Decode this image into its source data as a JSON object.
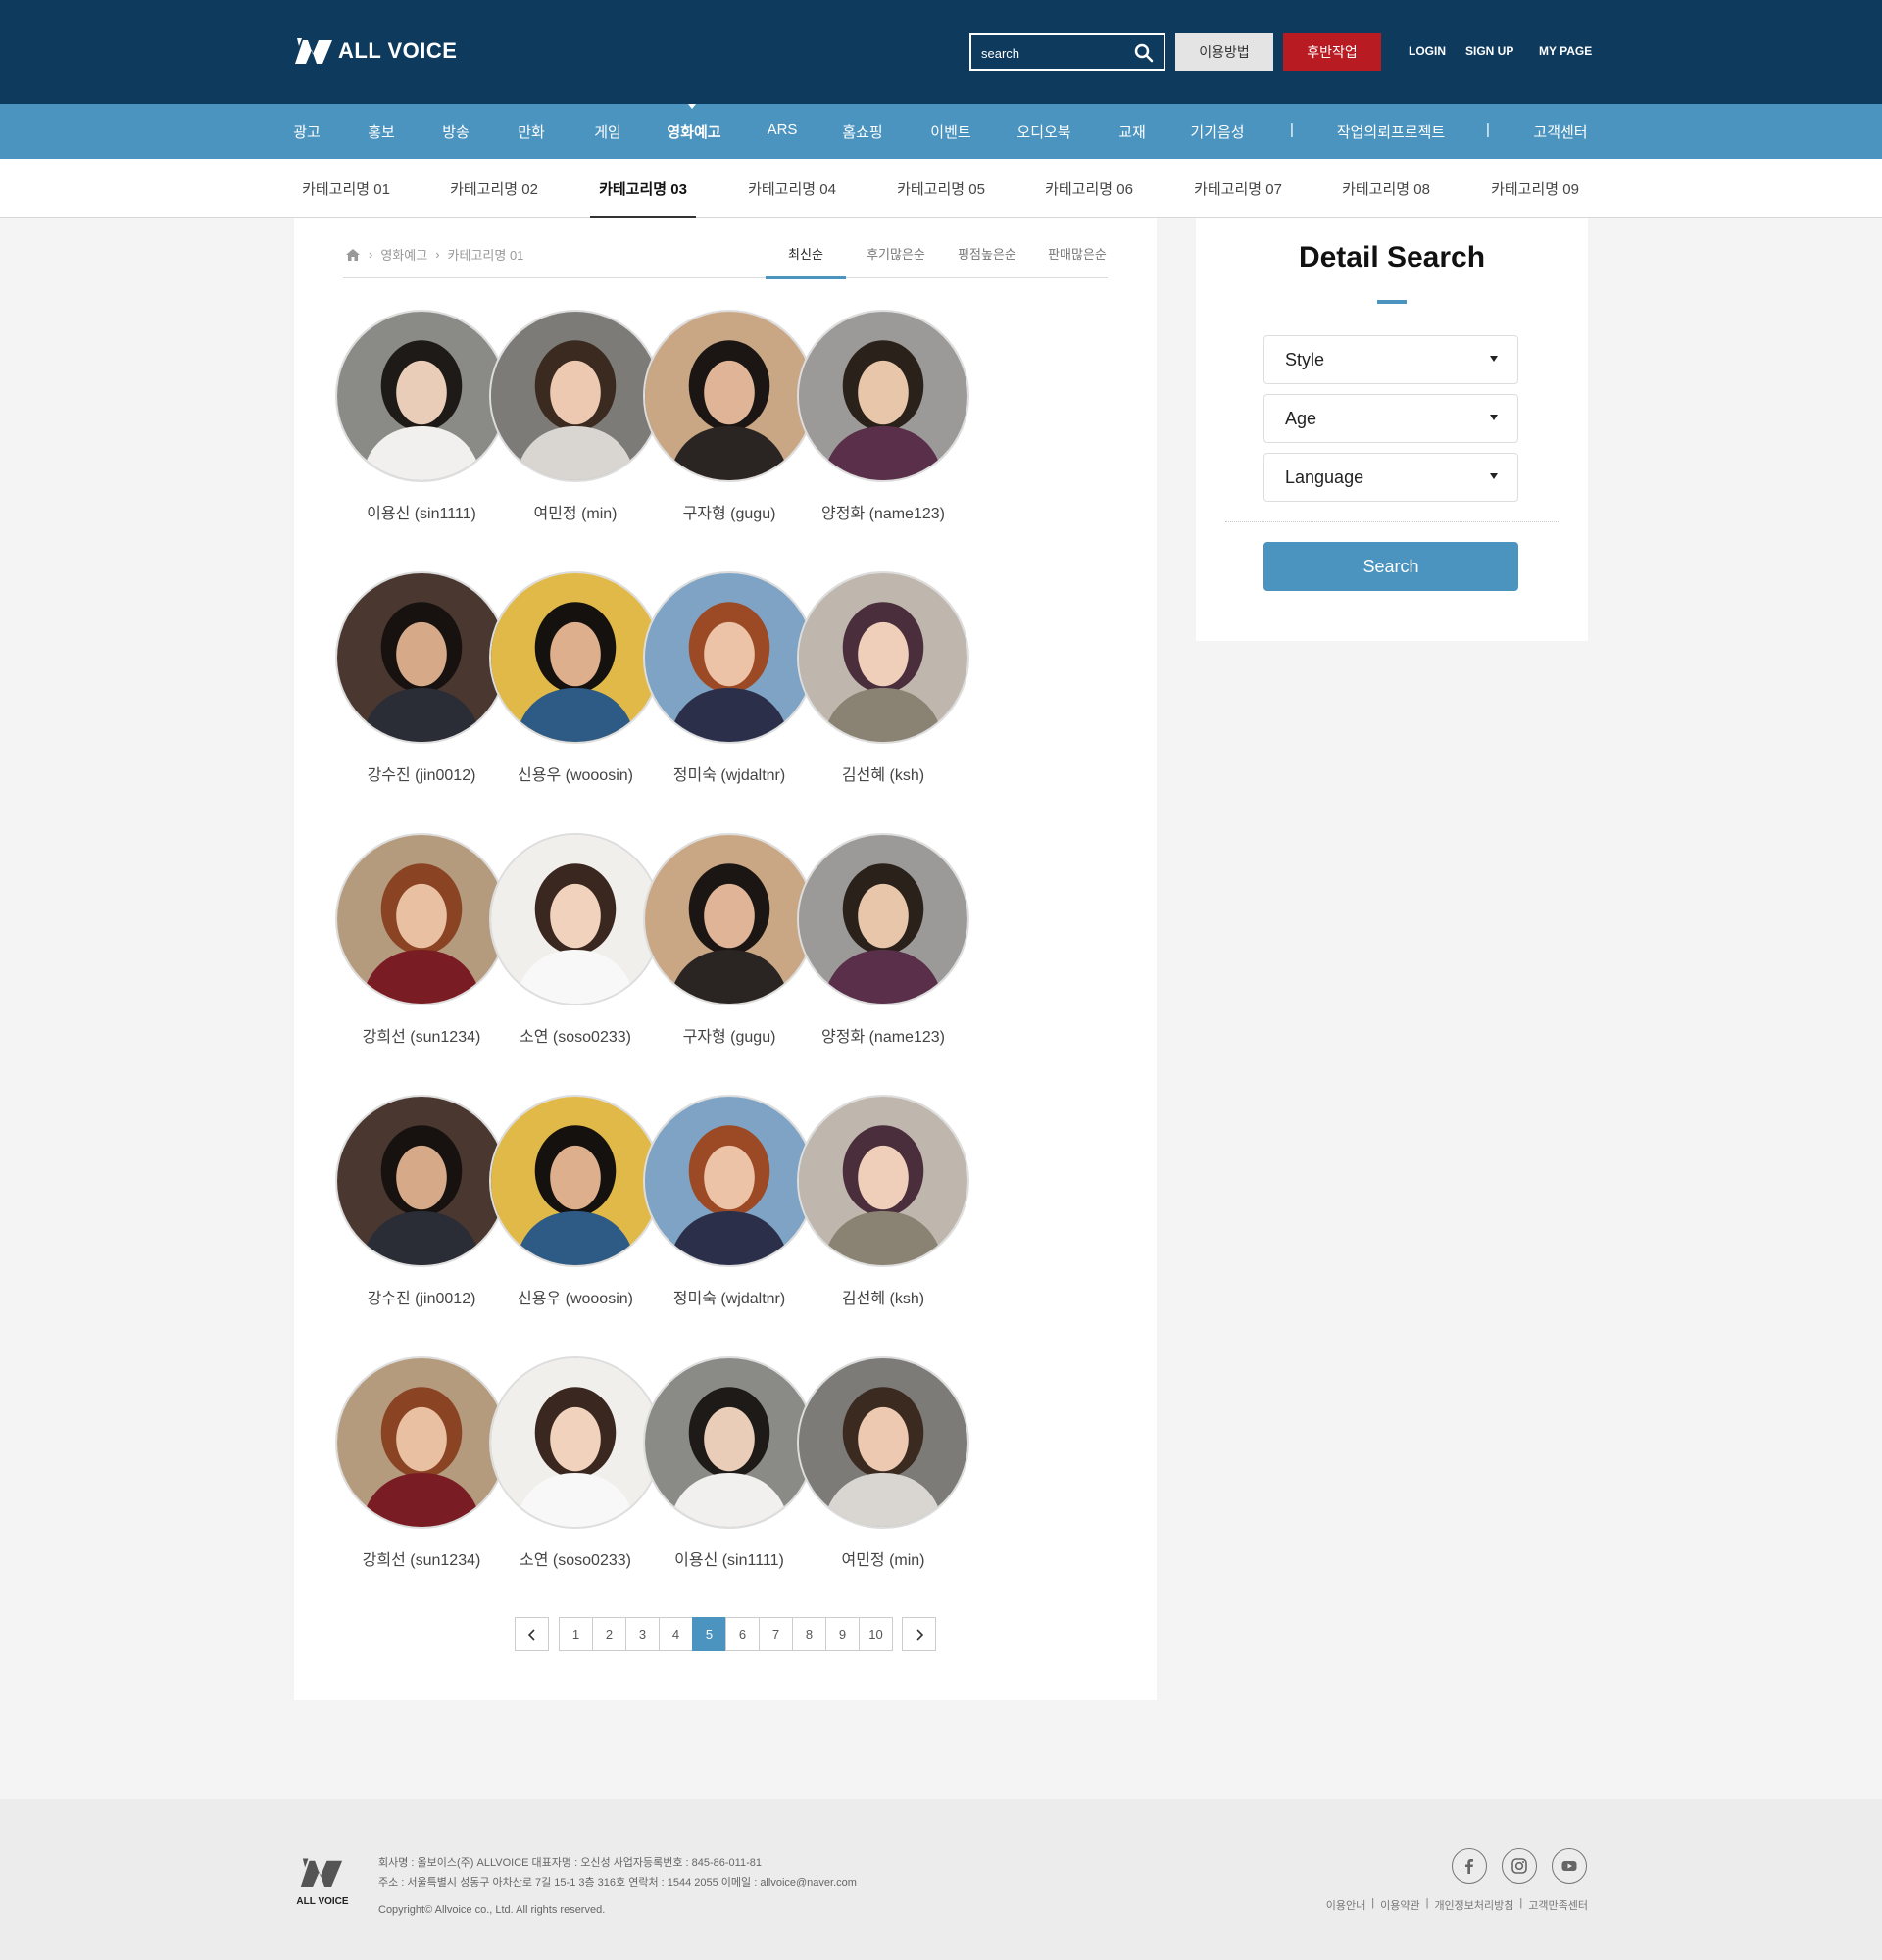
{
  "header": {
    "logo_text": "ALL VOICE",
    "search_placeholder": "search",
    "guide_label": "이용방법",
    "post_label": "후반작업",
    "login": "LOGIN",
    "signup": "SIGN UP",
    "mypage": "MY PAGE"
  },
  "nav": {
    "items": [
      "광고",
      "홍보",
      "방송",
      "만화",
      "게임",
      "영화예고",
      "ARS",
      "홈쇼핑",
      "이벤트",
      "오디오북",
      "교재",
      "기기음성",
      "|",
      "작업의뢰프로젝트",
      "|",
      "고객센터"
    ],
    "active": "영화예고"
  },
  "subnav": {
    "items": [
      "카테고리명 01",
      "카테고리명 02",
      "카테고리명 03",
      "카테고리명 04",
      "카테고리명 05",
      "카테고리명 06",
      "카테고리명 07",
      "카테고리명 08",
      "카테고리명 09"
    ],
    "active": "카테고리명 03"
  },
  "breadcrumb": {
    "level1": "영화예고",
    "level2": "카테고리명 01"
  },
  "sort": {
    "items": [
      "최신순",
      "후기많은순",
      "평점높은순",
      "판매많은순"
    ],
    "active": "최신순"
  },
  "voices": [
    {
      "name": "이용신 (sin1111)",
      "photo": "studio-woman-short-hair"
    },
    {
      "name": "여민정 (min)",
      "photo": "studio-woman-smiling"
    },
    {
      "name": "구자형 (gugu)",
      "photo": "man-glasses-microphone"
    },
    {
      "name": "양정화 (name123)",
      "photo": "woman-headphones-stripes"
    },
    {
      "name": "강수진 (jin0012)",
      "photo": "man-glasses-dark"
    },
    {
      "name": "신용우 (wooosin)",
      "photo": "man-blue-shirt"
    },
    {
      "name": "정미숙 (wjdaltnr)",
      "photo": "woman-plaid-jacket"
    },
    {
      "name": "김선혜 (ksh)",
      "photo": "woman-long-hair"
    },
    {
      "name": "강희선 (sun1234)",
      "photo": "woman-red-scarf"
    },
    {
      "name": "소연 (soso0233)",
      "photo": "woman-bob-hair"
    },
    {
      "name": "구자형 (gugu)",
      "photo": "man-glasses-microphone"
    },
    {
      "name": "양정화 (name123)",
      "photo": "woman-headphones-stripes"
    },
    {
      "name": "강수진 (jin0012)",
      "photo": "man-glasses-dark"
    },
    {
      "name": "신용우 (wooosin)",
      "photo": "man-blue-shirt"
    },
    {
      "name": "정미숙 (wjdaltnr)",
      "photo": "woman-plaid-jacket"
    },
    {
      "name": "김선혜 (ksh)",
      "photo": "woman-long-hair"
    },
    {
      "name": "강희선 (sun1234)",
      "photo": "woman-red-scarf"
    },
    {
      "name": "소연 (soso0233)",
      "photo": "woman-bob-hair"
    },
    {
      "name": "이용신 (sin1111)",
      "photo": "studio-woman-short-hair"
    },
    {
      "name": "여민정 (min)",
      "photo": "studio-woman-smiling"
    }
  ],
  "pagination": {
    "pages": [
      "1",
      "2",
      "3",
      "4",
      "5",
      "6",
      "7",
      "8",
      "9",
      "10"
    ],
    "current": "5"
  },
  "detail_search": {
    "title": "Detail Search",
    "style_label": "Style",
    "age_label": "Age",
    "language_label": "Language",
    "search_label": "Search"
  },
  "footer": {
    "logo_text": "ALL VOICE",
    "line1": "회사명 : 올보이스(주) ALLVOICE  대표자명 : 오신성  사업자등록번호 : 845-86-011-81",
    "line2": "주소 : 서울특별시 성동구 아차산로 7길 15-1 3층 316호  연락처 : 1544 2055  이메일 : allvoice@naver.com",
    "copyright": "Copyright© Allvoice co., Ltd. All rights reserved.",
    "links": [
      "이용안내",
      "이용약관",
      "개인정보처리방침",
      "고객만족센터"
    ]
  },
  "colors": {
    "header_bg": "#0e3a5d",
    "nav_bg": "#4b94bf",
    "accent": "#4b94bf",
    "post_button": "#b81c22"
  }
}
